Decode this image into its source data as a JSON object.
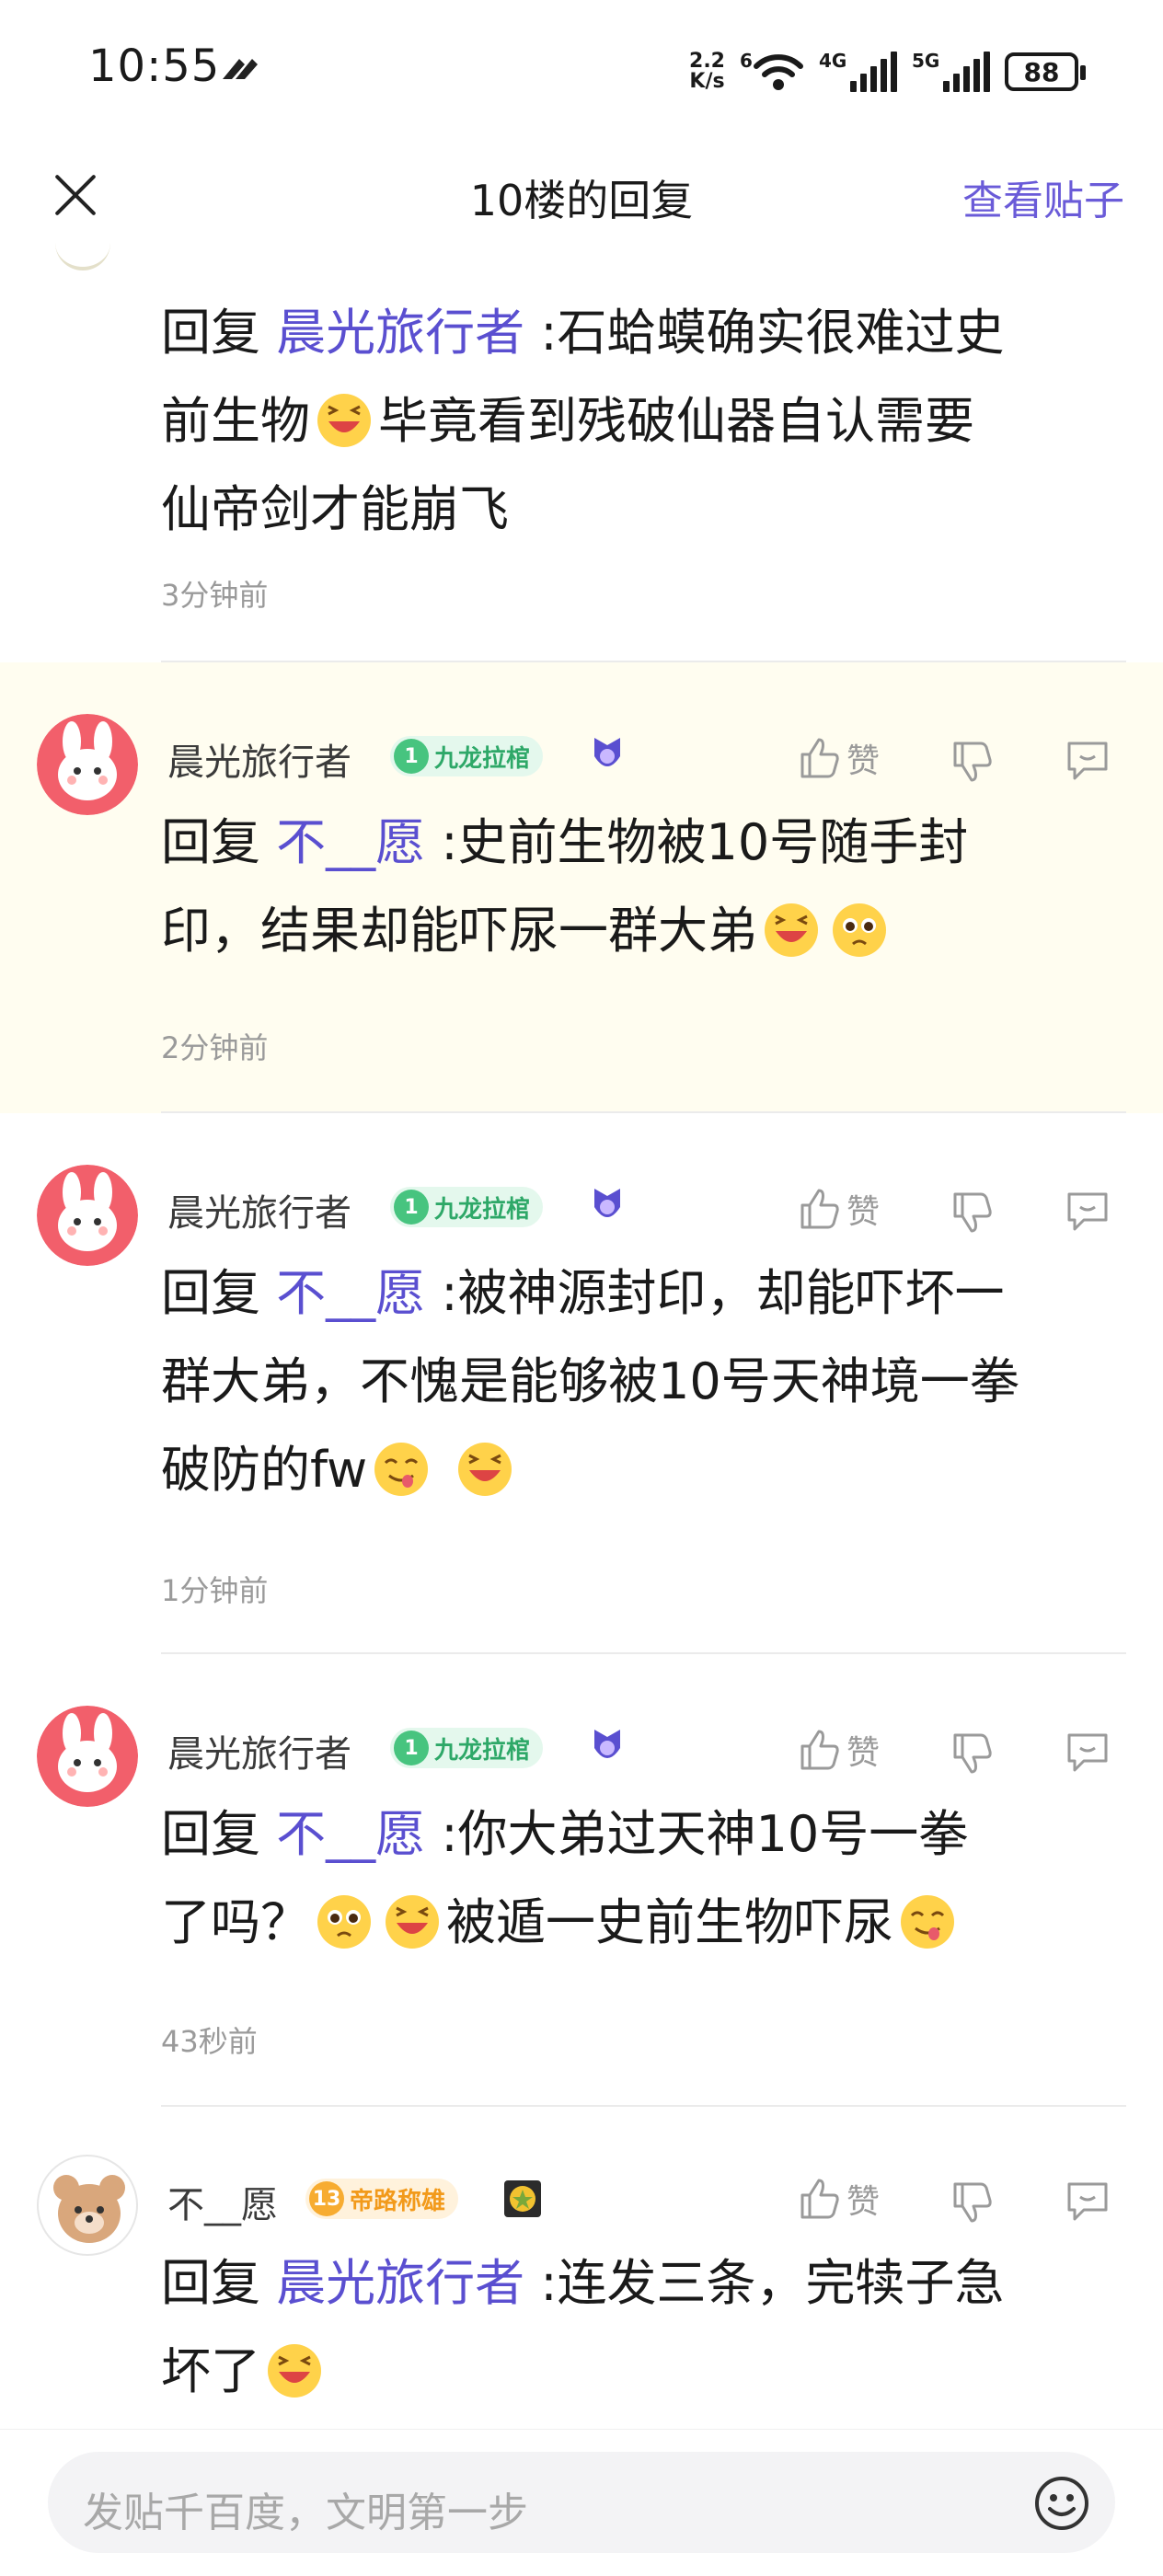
{
  "status_bar": {
    "time": "10:55",
    "net_speed_value": "2.2",
    "net_speed_unit": "K/s",
    "wifi_tag": "6",
    "sig1_tag": "4G",
    "sig2_tag": "5G",
    "battery": "88"
  },
  "header": {
    "title": "10楼的回复",
    "view_post": "查看贴子"
  },
  "replies": [
    {
      "reply_prefix": "回复",
      "reply_to": "晨光旅行者",
      "line1": " :石蛤蟆确实很难过史",
      "line2_a": "前生物",
      "line2_b": "毕竟看到残破仙器自认需要",
      "line3": "仙帝剑才能崩飞",
      "time": "3分钟前"
    },
    {
      "author": "晨光旅行者",
      "level": "1",
      "level_title": "九龙拉棺",
      "like": "赞",
      "reply_prefix": "回复",
      "reply_to": "不__愿",
      "line1": " :史前生物被10号随手封",
      "line2": "印，结果却能吓尿一群大弟",
      "time": "2分钟前"
    },
    {
      "author": "晨光旅行者",
      "level": "1",
      "level_title": "九龙拉棺",
      "like": "赞",
      "reply_prefix": "回复",
      "reply_to": "不__愿",
      "line1": " :被神源封印，却能吓坏一",
      "line2": "群大弟，不愧是能够被10号天神境一拳",
      "line3": "破防的fw",
      "time": "1分钟前"
    },
    {
      "author": "晨光旅行者",
      "level": "1",
      "level_title": "九龙拉棺",
      "like": "赞",
      "reply_prefix": "回复",
      "reply_to": "不__愿",
      "line1": " :你大弟过天神10号一拳",
      "line2_a": "了吗？",
      "line2_b": "被遁一史前生物吓尿",
      "time": "43秒前"
    },
    {
      "author": "不__愿",
      "level": "13",
      "level_title": "帝路称雄",
      "like": "赞",
      "reply_prefix": "回复",
      "reply_to": "晨光旅行者",
      "line1": " :连发三条，完犊子急",
      "line2": "坏了"
    }
  ],
  "input": {
    "placeholder": "发贴千百度，文明第一步"
  },
  "colors": {
    "accent": "#6a5bd8",
    "mention": "#5a4fd0",
    "highlight_bg": "#fffdf0",
    "level_green": "#47c47f",
    "level_orange": "#f7ac31"
  }
}
